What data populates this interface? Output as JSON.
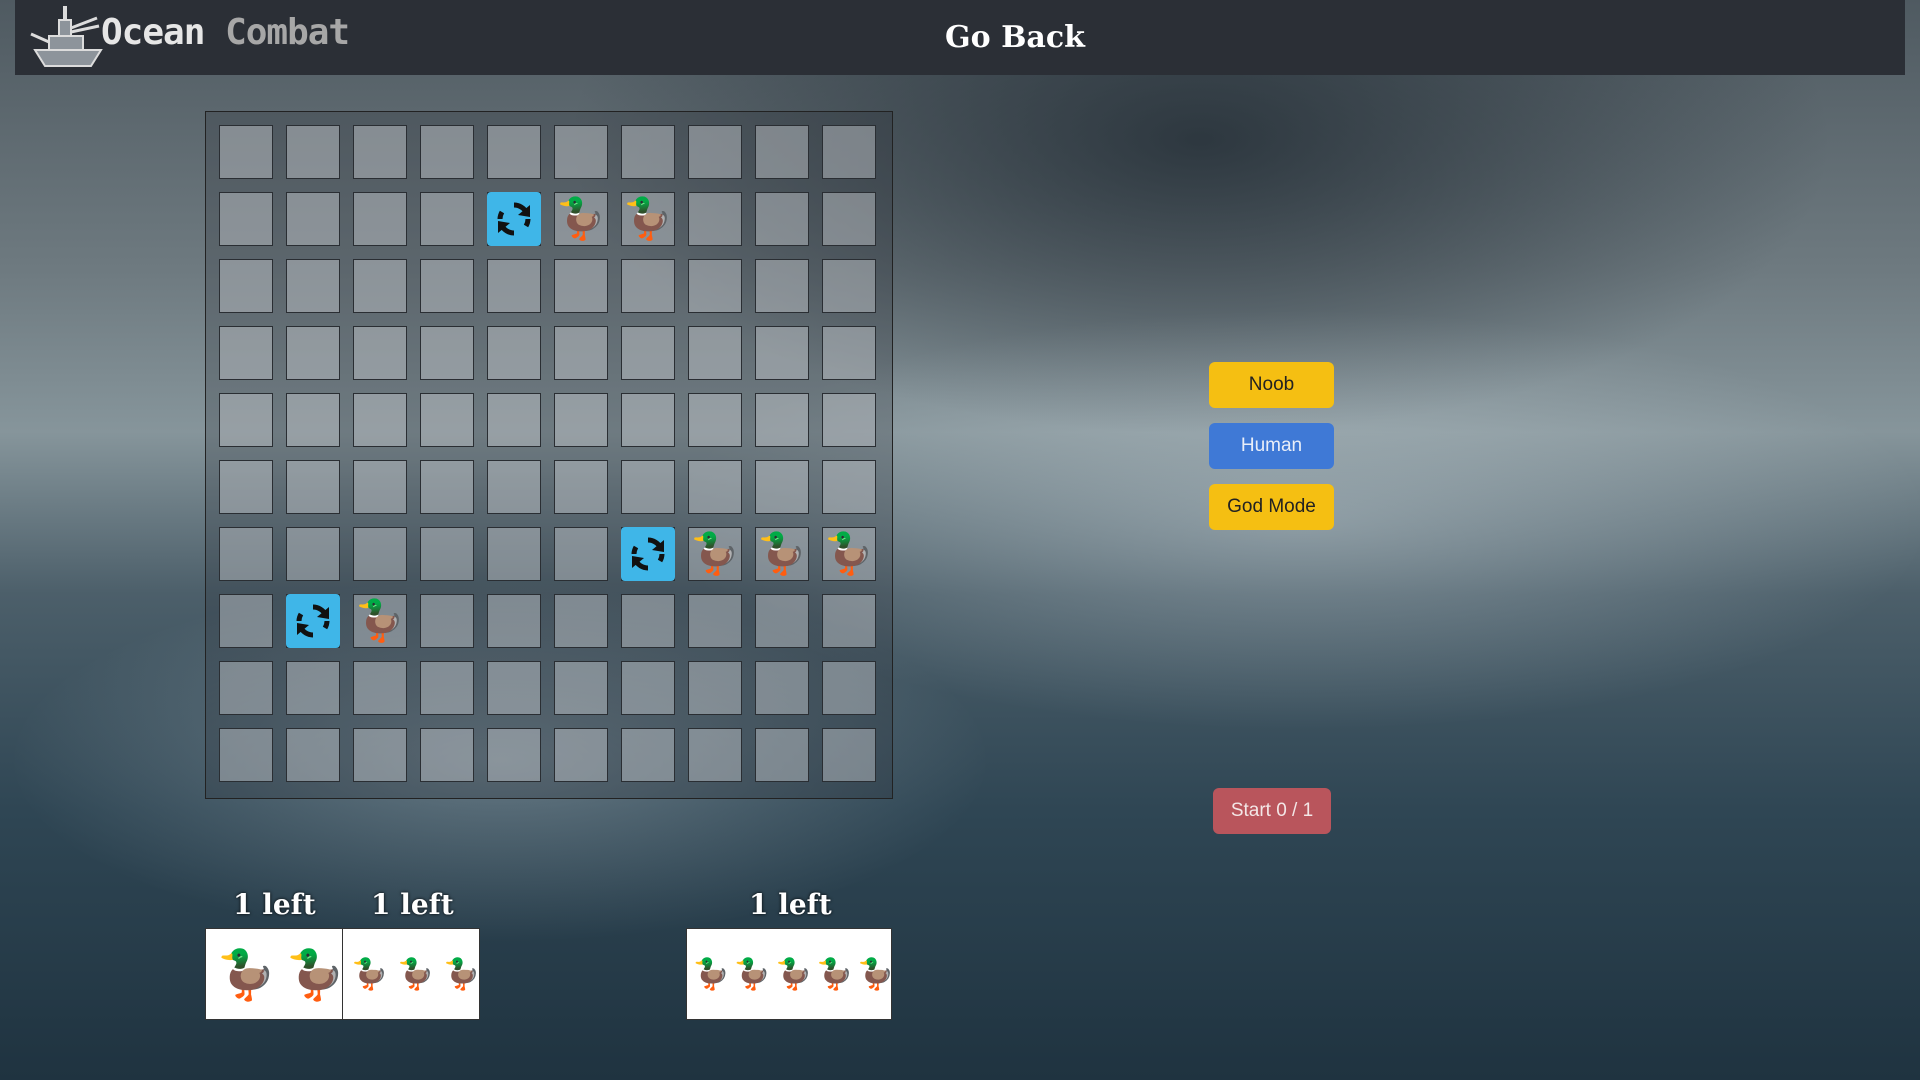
{
  "header": {
    "brand_word1": "Ocean",
    "brand_word2": "Combat",
    "go_back": "Go Back"
  },
  "board": {
    "rows": 10,
    "cols": 10,
    "ships": [
      {
        "row": 1,
        "cols": [
          4,
          5,
          6
        ],
        "rotate_at": 4
      },
      {
        "row": 6,
        "cols": [
          6,
          7,
          8,
          9
        ],
        "rotate_at": 6
      },
      {
        "row": 7,
        "cols": [
          1,
          2
        ],
        "rotate_at": 1
      }
    ]
  },
  "controls": {
    "noob": "Noob",
    "human": "Human",
    "god_mode": "God Mode",
    "start": "Start 0 / 1"
  },
  "trays": [
    {
      "label": "1 left",
      "ducks": 2
    },
    {
      "label": "1 left",
      "ducks": 3
    },
    {
      "label": "1 left",
      "ducks": 5
    }
  ],
  "colors": {
    "yellow_button": "#f5bf12",
    "blue_button": "#3f79d6",
    "start_button": "#b9555c",
    "rotate_tile": "#3fb6e8",
    "topbar": "#2b2f36"
  },
  "icons": {
    "logo": "battleship-icon",
    "ship_piece": "duck-icon",
    "rotate": "rotate-icon"
  }
}
